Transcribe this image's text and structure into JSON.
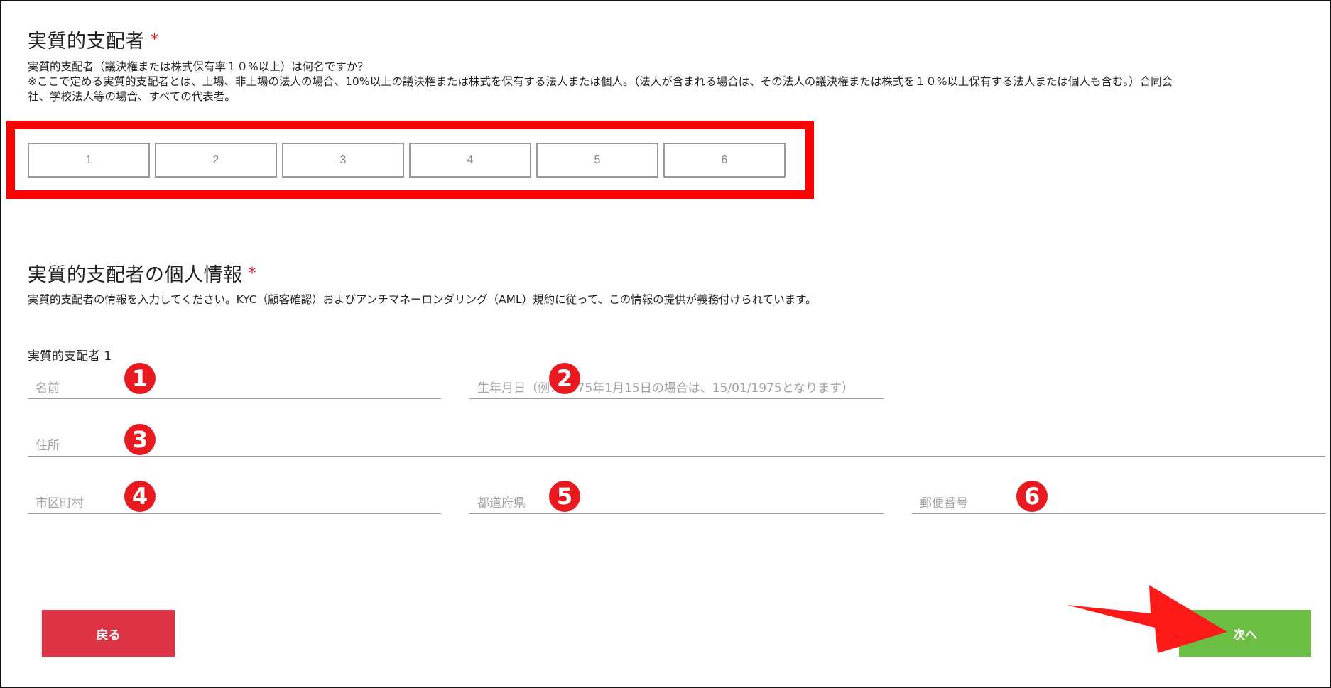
{
  "section1": {
    "title": "実質的支配者",
    "required_mark": "*",
    "question": "実質的支配者（議決権または株式保有率１０%以上）は何名ですか？",
    "note_line1": "※ここで定める実質的支配者とは、上場、非上場の法人の場合、10%以上の議決権または株式を保有する法人または個人。（法人が含まれる場合は、その法人の議決権または株式を１０%以上保有する法人または個人も含む。）合同会",
    "note_line2": "社、学校法人等の場合、すべての代表者。",
    "count_options": [
      "1",
      "2",
      "3",
      "4",
      "5",
      "6"
    ]
  },
  "section2": {
    "title": "実質的支配者の個人情報",
    "required_mark": "*",
    "description": "実質的支配者の情報を入力してください。KYC（顧客確認）およびアンチマネーロンダリング（AML）規約に従って、この情報の提供が義務付けられています。",
    "owner_label": "実質的支配者 1",
    "fields": {
      "name": {
        "placeholder": "名前",
        "value": ""
      },
      "dob": {
        "placeholder": "生年月日（例：1975年1月15日の場合は、15/01/1975となります）",
        "value": ""
      },
      "address": {
        "placeholder": "住所",
        "value": ""
      },
      "city": {
        "placeholder": "市区町村",
        "value": ""
      },
      "prefecture": {
        "placeholder": "都道府県",
        "value": ""
      },
      "postal": {
        "placeholder": "郵便番号",
        "value": ""
      }
    }
  },
  "annotations": {
    "badges": [
      "❶",
      "❷",
      "❸",
      "❹",
      "❺",
      "❻"
    ],
    "highlight_color": "#ff0000",
    "badge_color": "#e8191f"
  },
  "buttons": {
    "back": "戻る",
    "next": "次へ",
    "back_color": "#dc3445",
    "next_color": "#6cbe45"
  }
}
